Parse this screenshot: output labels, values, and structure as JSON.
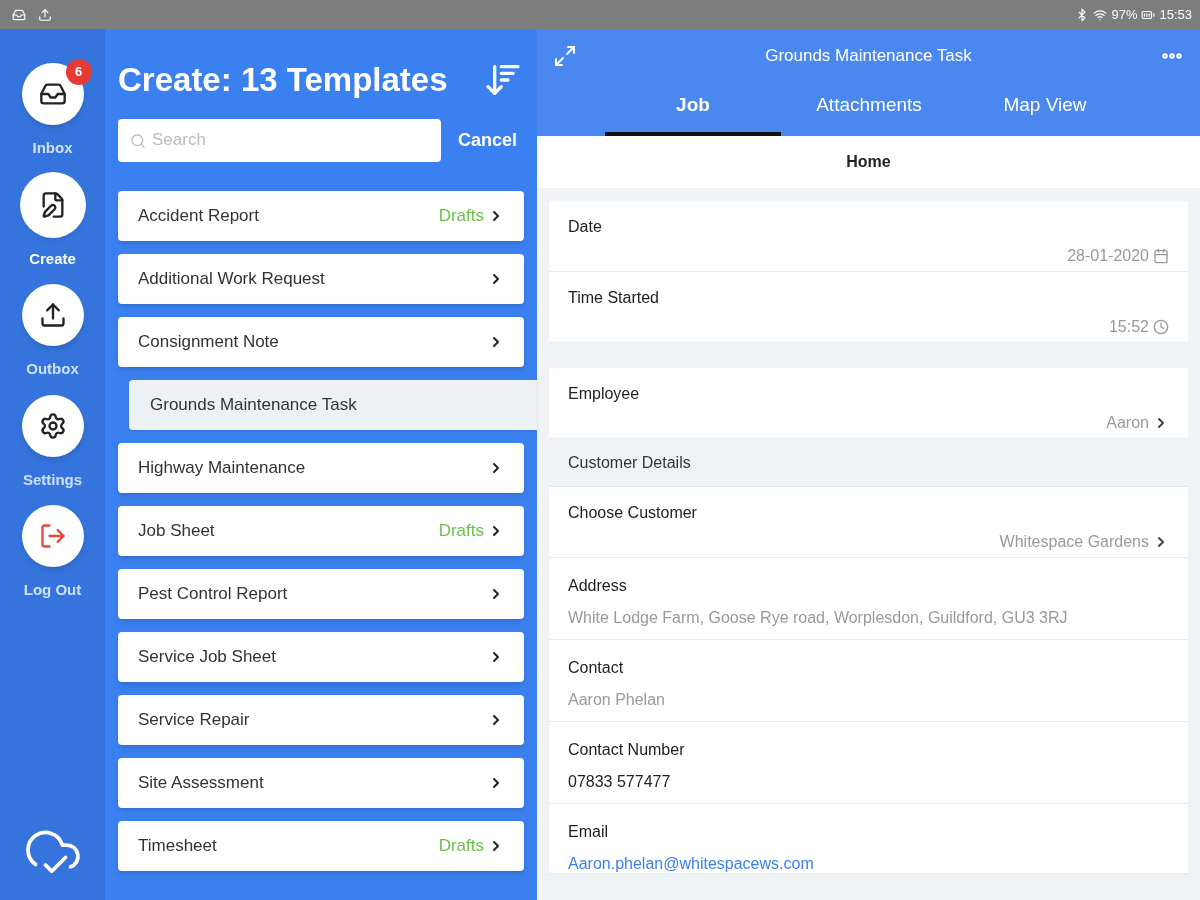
{
  "status_bar": {
    "battery": "97%",
    "time": "15:53"
  },
  "nav": [
    {
      "kind": "inbox",
      "label": "Inbox",
      "badge": "6",
      "selected": false
    },
    {
      "kind": "create",
      "label": "Create",
      "selected": true
    },
    {
      "kind": "outbox",
      "label": "Outbox",
      "selected": false
    },
    {
      "kind": "settings",
      "label": "Settings",
      "selected": false
    },
    {
      "kind": "logout",
      "label": "Log Out",
      "selected": false
    }
  ],
  "templates": {
    "title": "Create: 13 Templates",
    "search": {
      "placeholder": "Search"
    },
    "cancel": "Cancel",
    "items": [
      {
        "label": "Accident Report",
        "drafts": "Drafts",
        "selected": false
      },
      {
        "label": "Additional Work Request",
        "selected": false
      },
      {
        "label": "Consignment Note",
        "selected": false
      },
      {
        "label": "Grounds Maintenance Task",
        "selected": true
      },
      {
        "label": "Highway Maintenance",
        "selected": false
      },
      {
        "label": "Job Sheet",
        "drafts": "Drafts",
        "selected": false
      },
      {
        "label": "Pest Control Report",
        "selected": false
      },
      {
        "label": "Service Job Sheet",
        "selected": false
      },
      {
        "label": "Service Repair",
        "selected": false
      },
      {
        "label": "Site Assessment",
        "selected": false
      },
      {
        "label": "Timesheet",
        "drafts": "Drafts",
        "selected": false
      }
    ]
  },
  "form": {
    "title": "Grounds Maintenance Task",
    "tabs": [
      {
        "label": "Job",
        "selected": true
      },
      {
        "label": "Attachments",
        "selected": false
      },
      {
        "label": "Map View",
        "selected": false
      }
    ],
    "page": "Home",
    "fields": [
      {
        "kind": "date",
        "label": "Date",
        "value": "28-01-2020"
      },
      {
        "kind": "time",
        "label": "Time Started",
        "value": "15:52"
      },
      {
        "kind": "gap"
      },
      {
        "kind": "select",
        "label": "Employee",
        "value": "Aaron"
      },
      {
        "kind": "section",
        "label": "Customer Details"
      },
      {
        "kind": "select",
        "label": "Choose Customer",
        "value": "Whitespace Gardens"
      },
      {
        "kind": "text",
        "label": "Address",
        "value": "White Lodge Farm, Goose Rye road, Worplesdon, Guildford, GU3 3RJ"
      },
      {
        "kind": "text",
        "label": "Contact",
        "value": "Aaron Phelan"
      },
      {
        "kind": "strong",
        "label": "Contact Number",
        "value": "07833 577477"
      },
      {
        "kind": "link",
        "label": "Email",
        "value": "Aaron.phelan@whitespacews.com"
      }
    ]
  }
}
